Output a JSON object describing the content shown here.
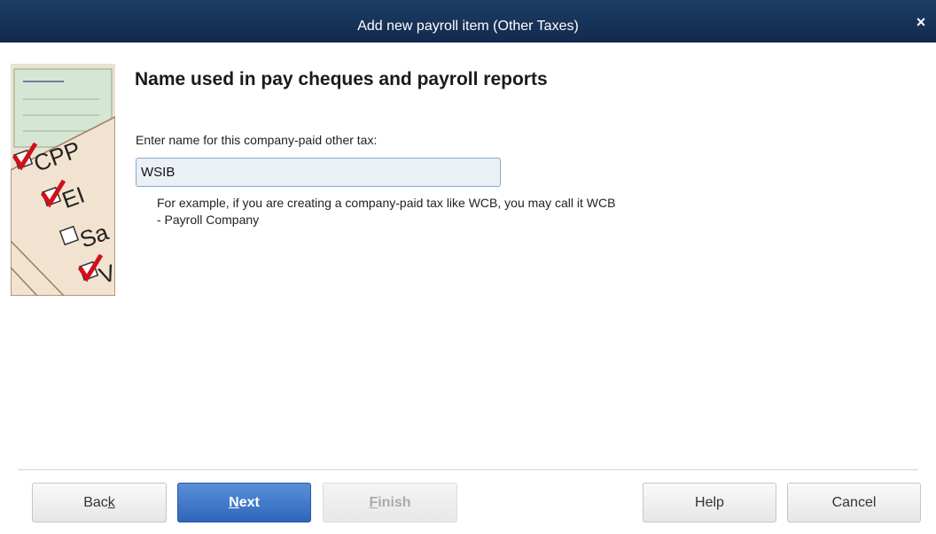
{
  "window": {
    "title": "Add new payroll item (Other Taxes)",
    "close_glyph": "×"
  },
  "side_art": {
    "description_icon": "payroll-checklist-illustration",
    "items": [
      {
        "label": "CPP",
        "checked": true
      },
      {
        "label": "EI",
        "checked": true
      },
      {
        "label": "Sa",
        "checked": false
      },
      {
        "label": "V",
        "checked": true
      }
    ]
  },
  "main": {
    "heading": "Name used in pay cheques and payroll reports",
    "field_label": "Enter name for this company-paid other tax:",
    "name_value": "WSIB",
    "hint_line1": "For example, if you are creating a company-paid tax like WCB, you may call it WCB",
    "hint_line2": "- Payroll Company"
  },
  "buttons": {
    "back": {
      "prefix": "Bac",
      "underline": "k",
      "suffix": ""
    },
    "next": {
      "prefix": "",
      "underline": "N",
      "suffix": "ext"
    },
    "finish": {
      "prefix": "",
      "underline": "F",
      "suffix": "inish"
    },
    "help": "Help",
    "cancel": "Cancel"
  },
  "colors": {
    "titlebar": "#1d3d66",
    "primary_button": "#3a72c6",
    "check_red": "#d0101b"
  }
}
